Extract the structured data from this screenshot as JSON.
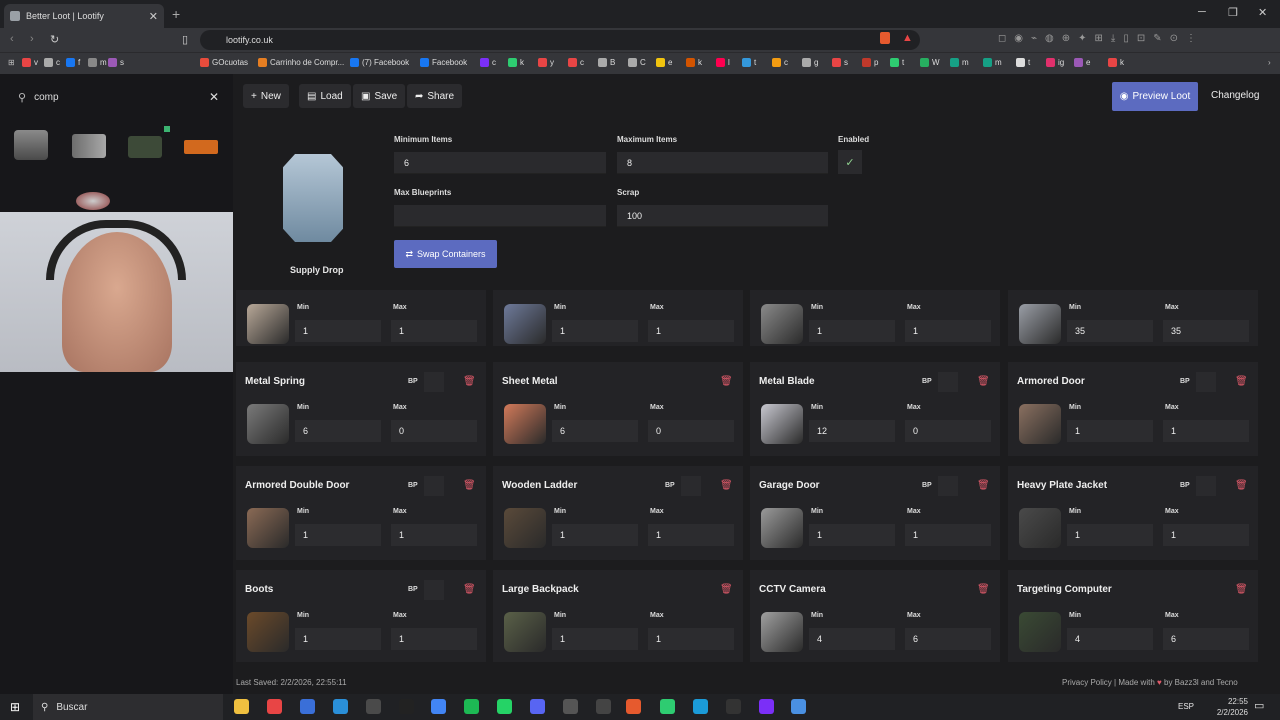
{
  "browser": {
    "tab_title": "Better Loot | Lootify",
    "tab_close": "✕",
    "new_tab": "+",
    "url": "lootify.co.uk",
    "window_controls": [
      "─",
      "❐",
      "✕"
    ],
    "bookmarks": [
      {
        "label": "v",
        "color": "#e84545"
      },
      {
        "label": "c",
        "color": "#aaaaaa"
      },
      {
        "label": "f",
        "color": "#1877f2"
      },
      {
        "label": "m",
        "color": "#888888"
      },
      {
        "label": "s",
        "color": "#9b59b6"
      },
      {
        "label": "GOcuotas",
        "color": "#e74c3c"
      },
      {
        "label": "Carrinho de Compr...",
        "color": "#e67e22"
      },
      {
        "label": "(7) Facebook",
        "color": "#1877f2"
      },
      {
        "label": "Facebook",
        "color": "#1877f2"
      },
      {
        "label": "c",
        "color": "#7b2ff7"
      },
      {
        "label": "k",
        "color": "#2ecc71"
      },
      {
        "label": "y",
        "color": "#e84545"
      },
      {
        "label": "c",
        "color": "#e84545"
      },
      {
        "label": "B",
        "color": "#aaaaaa"
      },
      {
        "label": "C",
        "color": "#aaaaaa"
      },
      {
        "label": "e",
        "color": "#f1c40f"
      },
      {
        "label": "k",
        "color": "#d35400"
      },
      {
        "label": "l",
        "color": "#ff0050"
      },
      {
        "label": "t",
        "color": "#3498db"
      },
      {
        "label": "c",
        "color": "#f39c12"
      },
      {
        "label": "g",
        "color": "#aaaaaa"
      },
      {
        "label": "s",
        "color": "#e84545"
      },
      {
        "label": "p",
        "color": "#c0392b"
      },
      {
        "label": "t",
        "color": "#2ecc71"
      },
      {
        "label": "W",
        "color": "#27ae60"
      },
      {
        "label": "m",
        "color": "#16a085"
      },
      {
        "label": "m",
        "color": "#16a085"
      },
      {
        "label": "t",
        "color": "#dddddd"
      },
      {
        "label": "ig",
        "color": "#e1306c"
      },
      {
        "label": "e",
        "color": "#9b59b6"
      },
      {
        "label": "k",
        "color": "#e84545"
      }
    ]
  },
  "sidebar": {
    "search_value": "comp",
    "search_icon": "search-icon",
    "clear_icon": "✕"
  },
  "toolbar": {
    "new_label": "New",
    "load_label": "Load",
    "save_label": "Save",
    "share_label": "Share",
    "preview_label": "Preview Loot",
    "changelog_label": "Changelog"
  },
  "container": {
    "name": "Supply Drop",
    "min_items_label": "Minimum Items",
    "min_items_value": "6",
    "max_items_label": "Maximum Items",
    "max_items_value": "8",
    "enabled_label": "Enabled",
    "enabled_check": "✓",
    "max_bp_label": "Max Blueprints",
    "max_bp_value": "",
    "scrap_label": "Scrap",
    "scrap_value": "100",
    "swap_label": "Swap Containers"
  },
  "items": [
    {
      "name": "",
      "bp": false,
      "min": "1",
      "max": "1"
    },
    {
      "name": "",
      "bp": false,
      "min": "1",
      "max": "1"
    },
    {
      "name": "",
      "bp": false,
      "min": "1",
      "max": "1"
    },
    {
      "name": "",
      "bp": false,
      "min": "35",
      "max": "35"
    },
    {
      "name": "Metal Spring",
      "bp": true,
      "min": "6",
      "max": "0"
    },
    {
      "name": "Sheet Metal",
      "bp": false,
      "min": "6",
      "max": "0"
    },
    {
      "name": "Metal Blade",
      "bp": true,
      "min": "12",
      "max": "0"
    },
    {
      "name": "Armored Door",
      "bp": true,
      "min": "1",
      "max": "1"
    },
    {
      "name": "Armored Double Door",
      "bp": true,
      "min": "1",
      "max": "1"
    },
    {
      "name": "Wooden Ladder",
      "bp": true,
      "min": "1",
      "max": "1"
    },
    {
      "name": "Garage Door",
      "bp": true,
      "min": "1",
      "max": "1"
    },
    {
      "name": "Heavy Plate Jacket",
      "bp": true,
      "min": "1",
      "max": "1"
    },
    {
      "name": "Boots",
      "bp": true,
      "min": "1",
      "max": "1"
    },
    {
      "name": "Large Backpack",
      "bp": false,
      "min": "1",
      "max": "1"
    },
    {
      "name": "CCTV Camera",
      "bp": false,
      "min": "4",
      "max": "6"
    },
    {
      "name": "Targeting Computer",
      "bp": false,
      "min": "4",
      "max": "6"
    }
  ],
  "labels": {
    "min": "Min",
    "max": "Max",
    "bp": "BP"
  },
  "footer": {
    "last_saved": "Last Saved: 2/2/2026, 22:55:11",
    "credits_pre": "Privacy Policy | Made with",
    "heart": "♥",
    "credits_post": "by Bazz3l and Tecno"
  },
  "taskbar": {
    "search_placeholder": "Buscar",
    "lang": "ESP",
    "time": "22:55",
    "date": "2/2/2026"
  },
  "colors": {
    "accent": "#5c6bc0",
    "delete": "#e05a6a"
  }
}
